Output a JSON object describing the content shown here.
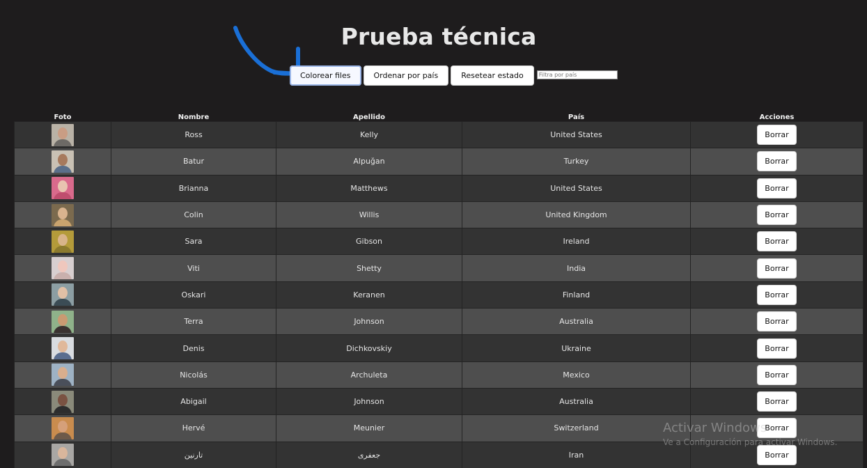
{
  "page": {
    "title": "Prueba técnica"
  },
  "toolbar": {
    "color_rows_label": "Colorear files",
    "sort_country_label": "Ordenar por país",
    "reset_label": "Resetear estado",
    "filter_placeholder": "Filtra por país"
  },
  "table": {
    "headers": {
      "photo": "Foto",
      "first_name": "Nombre",
      "last_name": "Apellido",
      "country": "País",
      "actions": "Acciones"
    },
    "delete_label": "Borrar",
    "rows": [
      {
        "first": "Ross",
        "last": "Kelly",
        "country": "United States"
      },
      {
        "first": "Batur",
        "last": "Alpuğan",
        "country": "Turkey"
      },
      {
        "first": "Brianna",
        "last": "Matthews",
        "country": "United States"
      },
      {
        "first": "Colin",
        "last": "Willis",
        "country": "United Kingdom"
      },
      {
        "first": "Sara",
        "last": "Gibson",
        "country": "Ireland"
      },
      {
        "first": "Viti",
        "last": "Shetty",
        "country": "India"
      },
      {
        "first": "Oskari",
        "last": "Keranen",
        "country": "Finland"
      },
      {
        "first": "Terra",
        "last": "Johnson",
        "country": "Australia"
      },
      {
        "first": "Denis",
        "last": "Dichkovskiy",
        "country": "Ukraine"
      },
      {
        "first": "Nicolás",
        "last": "Archuleta",
        "country": "Mexico"
      },
      {
        "first": "Abigail",
        "last": "Johnson",
        "country": "Australia"
      },
      {
        "first": "Hervé",
        "last": "Meunier",
        "country": "Switzerland"
      },
      {
        "first": "تارنین",
        "last": "جعفری",
        "country": "Iran"
      }
    ]
  },
  "avatars": [
    {
      "bg": "#b9b2a6",
      "skin": "#c99d84",
      "shirt": "#6d6a66"
    },
    {
      "bg": "#c9c1b4",
      "skin": "#a77a5d",
      "shirt": "#5b6f8a"
    },
    {
      "bg": "#d96a8c",
      "skin": "#e8c4b0",
      "shirt": "#bf4d6e"
    },
    {
      "bg": "#7b6a4e",
      "skin": "#d9b38e",
      "shirt": "#c9a36e"
    },
    {
      "bg": "#b49b3a",
      "skin": "#d8b48a",
      "shirt": "#8c7a2e"
    },
    {
      "bg": "#d8cfd0",
      "skin": "#efc7bd",
      "shirt": "#c9b0ad"
    },
    {
      "bg": "#8c9ea3",
      "skin": "#e1c0a6",
      "shirt": "#3b4c55"
    },
    {
      "bg": "#8fb28a",
      "skin": "#c99a72",
      "shirt": "#3a3230"
    },
    {
      "bg": "#d9dce0",
      "skin": "#e0b89a",
      "shirt": "#5a6d8f"
    },
    {
      "bg": "#9eb2c4",
      "skin": "#d8ae8e",
      "shirt": "#4a4f5a"
    },
    {
      "bg": "#8a8a7a",
      "skin": "#7a5242",
      "shirt": "#2d2d2d"
    },
    {
      "bg": "#c98c4e",
      "skin": "#d5a07a",
      "shirt": "#6d5a4a"
    },
    {
      "bg": "#a9a7a4",
      "skin": "#d9b69c",
      "shirt": "#6e6e6e"
    }
  ],
  "annotation": {
    "arrow_color": "#1a6fd6"
  },
  "watermark": {
    "title": "Activar Windows",
    "subtitle": "Ve a Configuración para activar Windows."
  }
}
